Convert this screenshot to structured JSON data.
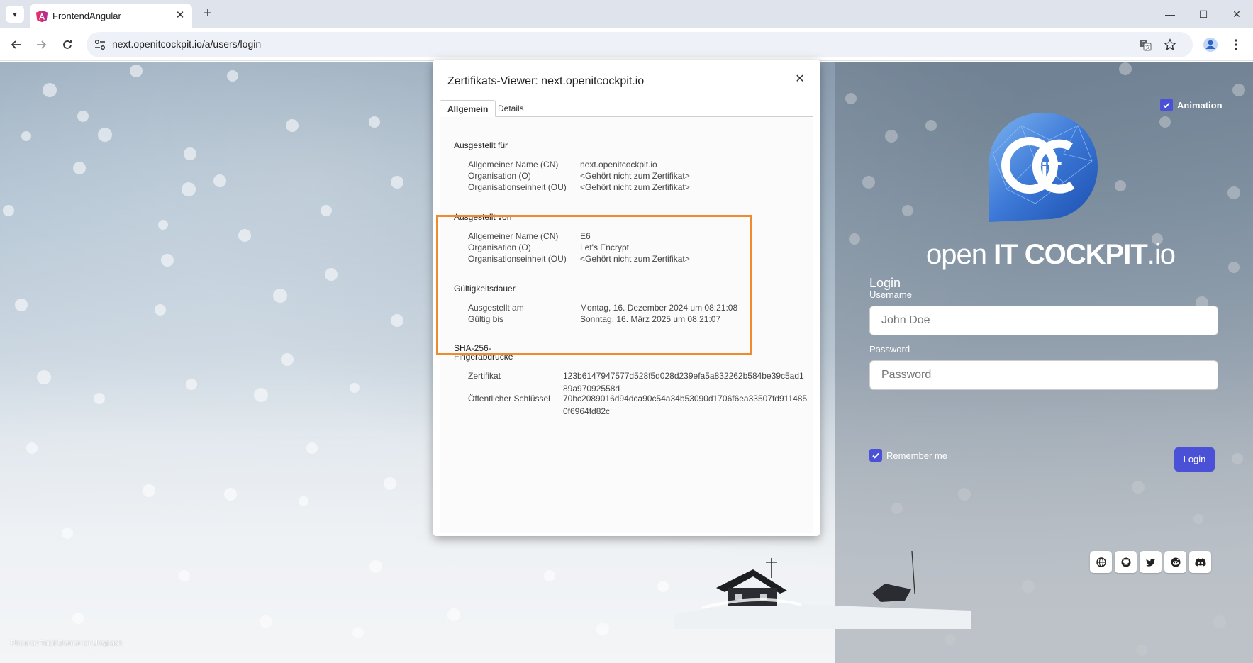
{
  "browser": {
    "tab_title": "FrontendAngular",
    "url": "next.openitcockpit.io/a/users/login",
    "minimize_icon": "minimize-icon",
    "maximize_icon": "maximize-icon",
    "close_icon": "close-icon"
  },
  "dialog": {
    "title": "Zertifikats-Viewer: next.openitcockpit.io",
    "tabs": [
      "Allgemein",
      "Details"
    ],
    "issued_to": {
      "heading": "Ausgestellt für",
      "rows": [
        {
          "key": "Allgemeiner Name (CN)",
          "value": "next.openitcockpit.io"
        },
        {
          "key": "Organisation (O)",
          "value": "<Gehört nicht zum Zertifikat>"
        },
        {
          "key": "Organisationseinheit (OU)",
          "value": "<Gehört nicht zum Zertifikat>"
        }
      ]
    },
    "issued_by": {
      "heading": "Ausgestellt von",
      "rows": [
        {
          "key": "Allgemeiner Name (CN)",
          "value": "E6"
        },
        {
          "key": "Organisation (O)",
          "value": "Let's Encrypt"
        },
        {
          "key": "Organisationseinheit (OU)",
          "value": "<Gehört nicht zum Zertifikat>"
        }
      ]
    },
    "validity": {
      "heading": "Gültigkeitsdauer",
      "rows": [
        {
          "key": "Ausgestellt am",
          "value": "Montag, 16. Dezember 2024 um 08:21:08"
        },
        {
          "key": "Gültig bis",
          "value": "Sonntag, 16. März 2025 um 08:21:07"
        }
      ]
    },
    "fingerprints": {
      "heading_line1": "SHA-256-",
      "heading_line2": "Fingerabdrücke",
      "rows": [
        {
          "key": "Zertifikat",
          "value": "123b6147947577d528f5d028d239efa5a832262b584be39c5ad189a97092558d"
        },
        {
          "key": "Öffentlicher Schlüssel",
          "value": "70bc2089016d94dca90c54a34b53090d1706f6ea33507fd9114850f6964fd82c"
        }
      ]
    },
    "highlight_color": "#f08a2e"
  },
  "login": {
    "animation_label": "Animation",
    "brand_light": "open ",
    "brand_bold": "IT COCKPIT",
    "brand_suffix": ".io",
    "title": "Login",
    "username_label": "Username",
    "username_placeholder": "John Doe",
    "password_label": "Password",
    "password_placeholder": "Password",
    "remember_label": "Remember me",
    "login_button": "Login",
    "accent_color": "#4a51d6",
    "social_icons": [
      "globe-icon",
      "github-icon",
      "twitter-icon",
      "reddit-icon",
      "discord-icon"
    ]
  },
  "photo_credit": "Photo by Todd Diemer on Unsplash"
}
